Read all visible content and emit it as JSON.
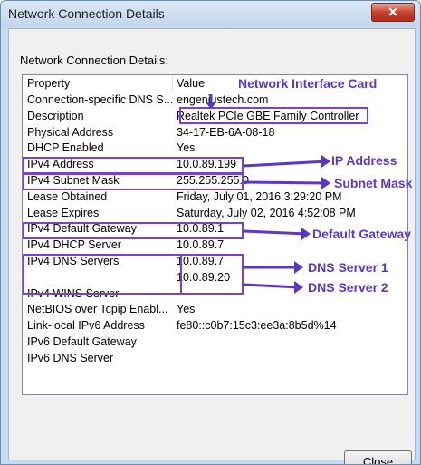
{
  "window": {
    "title": "Network Connection Details",
    "close_glyph": "✕"
  },
  "caption": "Network Connection Details:",
  "columns": [
    "Property",
    "Value"
  ],
  "rows": [
    [
      "Connection-specific DNS S...",
      "engeniustech.com"
    ],
    [
      "Description",
      "Realtek PCIe GBE Family Controller"
    ],
    [
      "Physical Address",
      "34-17-EB-6A-08-18"
    ],
    [
      "DHCP Enabled",
      "Yes"
    ],
    [
      "IPv4 Address",
      "10.0.89.199"
    ],
    [
      "IPv4 Subnet Mask",
      "255.255.255.0"
    ],
    [
      "Lease Obtained",
      "Friday, July 01, 2016 3:29:20 PM"
    ],
    [
      "Lease Expires",
      "Saturday, July 02, 2016 4:52:08 PM"
    ],
    [
      "IPv4 Default Gateway",
      "10.0.89.1"
    ],
    [
      "IPv4 DHCP Server",
      "10.0.89.7"
    ],
    [
      "IPv4 DNS Servers",
      "10.0.89.7"
    ],
    [
      "",
      "10.0.89.20"
    ],
    [
      "IPv4 WINS Server",
      ""
    ],
    [
      "NetBIOS over Tcpip Enabl...",
      "Yes"
    ],
    [
      "Link-local IPv6 Address",
      "fe80::c0b7:15c3:ee3a:8b5d%14"
    ],
    [
      "IPv6 Default Gateway",
      ""
    ],
    [
      "IPv6 DNS Server",
      ""
    ]
  ],
  "annotations": {
    "nic": "Network Interface Card",
    "ip": "IP Address",
    "subnet": "Subnet Mask",
    "gateway": "Default Gateway",
    "dns1": "DNS Server 1",
    "dns2": "DNS Server 2"
  },
  "buttons": {
    "close": "Close"
  },
  "colors": {
    "annotation": "#5a37c8",
    "highlight": "#7b3fd3",
    "close_button": "#c7412c"
  }
}
